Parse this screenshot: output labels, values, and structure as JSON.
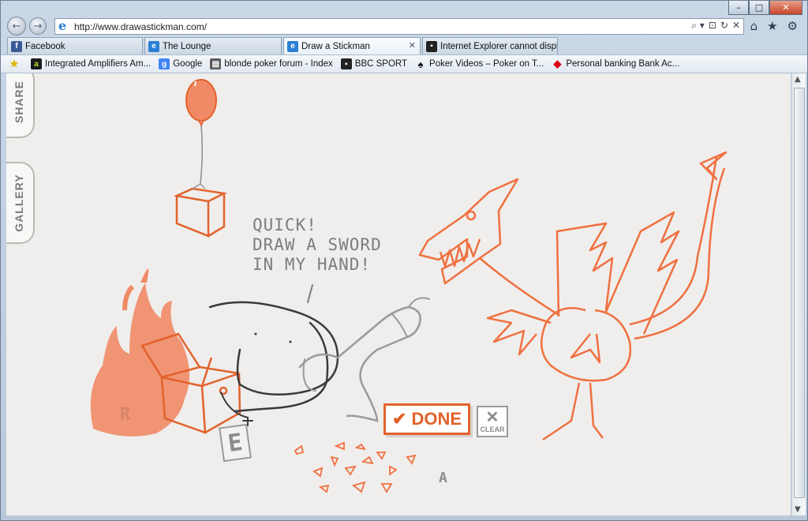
{
  "window": {
    "controls": [
      "–",
      "□",
      "✕"
    ]
  },
  "nav": {
    "back_icon": "back-arrow-icon",
    "forward_icon": "forward-arrow-icon",
    "url": "http://www.drawastickman.com/",
    "tools": [
      "⌕ ▾",
      "⊡",
      "↻",
      "✕"
    ],
    "right_tools": [
      "⌂",
      "★",
      "⚙"
    ]
  },
  "tabs": [
    {
      "label": "Facebook",
      "icon_color": "#3b5998",
      "icon_char": "f"
    },
    {
      "label": "The Lounge",
      "icon_color": "#2a7fd4",
      "icon_char": "e"
    },
    {
      "label": "Draw a Stickman",
      "icon_color": "#2a7fd4",
      "icon_char": "e",
      "close": "✕"
    },
    {
      "label": "Internet Explorer cannot displa...",
      "icon_color": "#222222",
      "icon_char": "▪"
    }
  ],
  "favorites": [
    {
      "label": "",
      "icon_color": "#e0b400",
      "icon_char": "★"
    },
    {
      "label": "Integrated Amplifiers  Am...",
      "icon_color": "#1a1a1a",
      "icon_char": "a"
    },
    {
      "label": "Google",
      "icon_color": "#4285f4",
      "icon_char": "g"
    },
    {
      "label": "blonde poker forum - Index",
      "icon_color": "#5a5a5a",
      "icon_char": "▤"
    },
    {
      "label": "BBC SPORT",
      "icon_color": "#222222",
      "icon_char": "▪"
    },
    {
      "label": "Poker Videos – Poker on T...",
      "icon_color": "#111111",
      "icon_char": "♠"
    },
    {
      "label": "Personal banking Bank Ac...",
      "icon_color": "#db0011",
      "icon_char": "◆"
    }
  ],
  "content": {
    "share_label": "SHARE",
    "gallery_label": "GALLERY",
    "speech": "QUICK!\nDRAW A SWORD\nIN MY HAND!",
    "done_label": "DONE",
    "done_check": "✔",
    "clear_label": "CLEAR",
    "clear_icon": "✕",
    "letters": [
      "R",
      "E",
      "A"
    ]
  },
  "colors": {
    "accent_orange": "#e2622c",
    "fire": "#f08a66",
    "pencil_gray": "#7d7d7d",
    "ink_dark": "#3a3a3a"
  }
}
